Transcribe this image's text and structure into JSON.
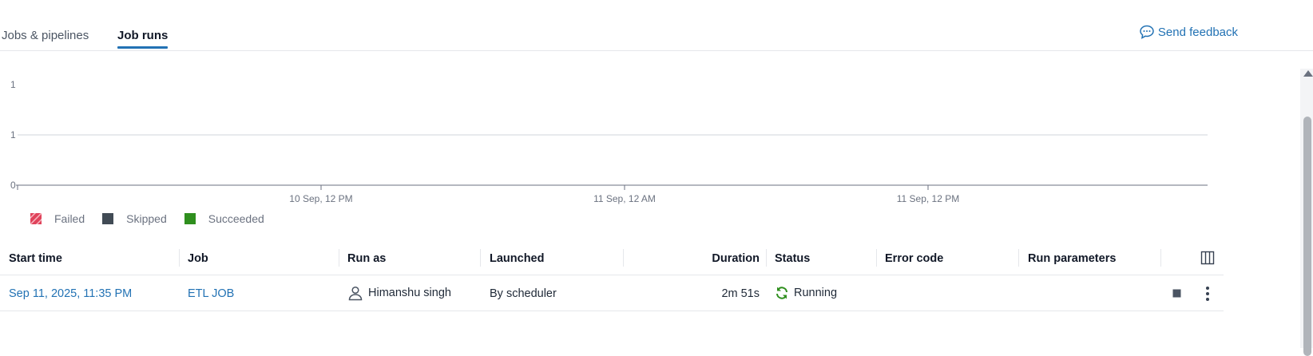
{
  "tabs": [
    {
      "label": "Jobs & pipelines",
      "active": false
    },
    {
      "label": "Job runs",
      "active": true
    }
  ],
  "feedback": {
    "label": "Send feedback",
    "icon": "chat-bubble-icon"
  },
  "chart_data": {
    "type": "bar",
    "y_ticks": [
      "1",
      "1",
      "0"
    ],
    "x_ticks": [
      "10 Sep, 12 PM",
      "11 Sep, 12 AM",
      "11 Sep, 12 PM"
    ],
    "series": [
      {
        "name": "Failed",
        "color": "#e0435b",
        "values": []
      },
      {
        "name": "Skipped",
        "color": "#414b55",
        "values": []
      },
      {
        "name": "Succeeded",
        "color": "#2f8f1e",
        "values": []
      }
    ],
    "grid": true,
    "legend": "bottom-left"
  },
  "table": {
    "columns": [
      "Start time",
      "Job",
      "Run as",
      "Launched",
      "Duration",
      "Status",
      "Error code",
      "Run parameters"
    ],
    "rows": [
      {
        "start_time": "Sep 11, 2025, 11:35 PM",
        "job": "ETL JOB",
        "run_as": "Himanshu singh",
        "launched": "By scheduler",
        "duration": "2m 51s",
        "status": "Running",
        "error_code": "",
        "run_parameters": ""
      }
    ]
  },
  "colors": {
    "accent": "#2272b4",
    "running": "#2f8f1e"
  }
}
